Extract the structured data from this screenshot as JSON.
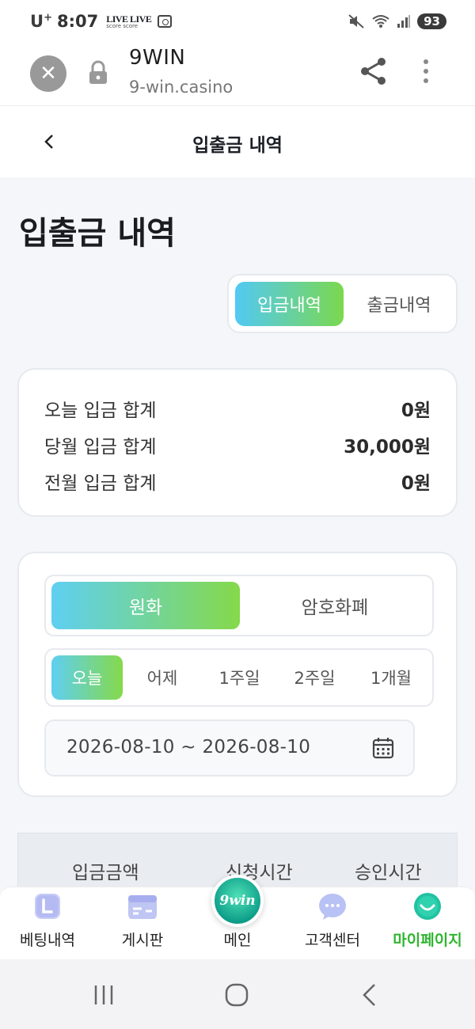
{
  "status_bar": {
    "carrier": "U",
    "carrier_sup": "+",
    "time": "8:07",
    "live_badge_top": "LIVE LIVE",
    "live_badge_bottom": "score score",
    "battery": "93"
  },
  "browser": {
    "close_icon": "close-icon",
    "site_title": "9WIN",
    "site_url": "9-win.casino"
  },
  "page_header": {
    "back_icon": "chevron-left-icon",
    "title": "입출금 내역"
  },
  "main": {
    "title": "입출금 내역",
    "tabs": [
      {
        "label": "입금내역",
        "active": true
      },
      {
        "label": "출금내역",
        "active": false
      }
    ],
    "summary": [
      {
        "label": "오늘 입금 합계",
        "value": "0원"
      },
      {
        "label": "당월 입금 합계",
        "value": "30,000원"
      },
      {
        "label": "전월 입금 합계",
        "value": "0원"
      }
    ],
    "currency": [
      {
        "label": "원화",
        "active": true
      },
      {
        "label": "암호화폐",
        "active": false
      }
    ],
    "periods": [
      {
        "label": "오늘",
        "active": true
      },
      {
        "label": "어제",
        "active": false
      },
      {
        "label": "1주일",
        "active": false
      },
      {
        "label": "2주일",
        "active": false
      },
      {
        "label": "1개월",
        "active": false
      }
    ],
    "date_range": "2026-08-10 ~ 2026-08-10",
    "table_headers": [
      "입금금액",
      "신청시간",
      "승인시간"
    ]
  },
  "bottom_nav": {
    "home_logo": "9win",
    "items": [
      {
        "label": "베팅내역",
        "icon": "betting-history-icon",
        "active": false
      },
      {
        "label": "게시판",
        "icon": "board-icon",
        "active": false
      },
      {
        "label": "메인",
        "icon": "home-logo-icon",
        "active": false
      },
      {
        "label": "고객센터",
        "icon": "chat-icon",
        "active": false
      },
      {
        "label": "마이페이지",
        "icon": "smile-icon",
        "active": true
      }
    ]
  },
  "colors": {
    "accent_gradient_start": "#52c9f4",
    "accent_gradient_end": "#7bd84e",
    "active_nav": "#2fb52f"
  }
}
